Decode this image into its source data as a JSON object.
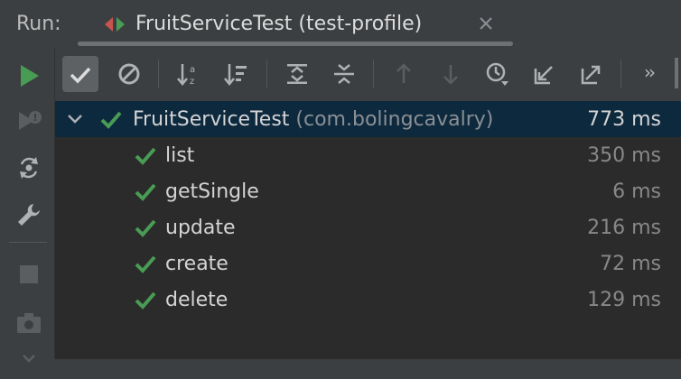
{
  "header": {
    "run_label": "Run:",
    "tab_title": "FruitServiceTest (test-profile)"
  },
  "side_toolbar": {
    "icons": [
      "rerun-icon",
      "rerun-failed-icon",
      "toggle-auto-test-icon",
      "settings-wrench-icon",
      "stop-icon",
      "screenshot-camera-icon"
    ]
  },
  "toolbar": {
    "more_label": "››"
  },
  "tree": {
    "root": {
      "name": "FruitServiceTest",
      "package": "(com.bolingcavalry)",
      "time": "773 ms",
      "status": "passed"
    },
    "tests": [
      {
        "name": "list",
        "time": "350 ms",
        "status": "passed"
      },
      {
        "name": "getSingle",
        "time": "6 ms",
        "status": "passed"
      },
      {
        "name": "update",
        "time": "216 ms",
        "status": "passed"
      },
      {
        "name": "create",
        "time": "72 ms",
        "status": "passed"
      },
      {
        "name": "delete",
        "time": "129 ms",
        "status": "passed"
      }
    ]
  },
  "colors": {
    "pass_green": "#499c54",
    "run_green": "#499c54",
    "selection": "#0d293e",
    "tree_bg": "#2b2b2b",
    "panel_bg": "#3c3f41"
  }
}
